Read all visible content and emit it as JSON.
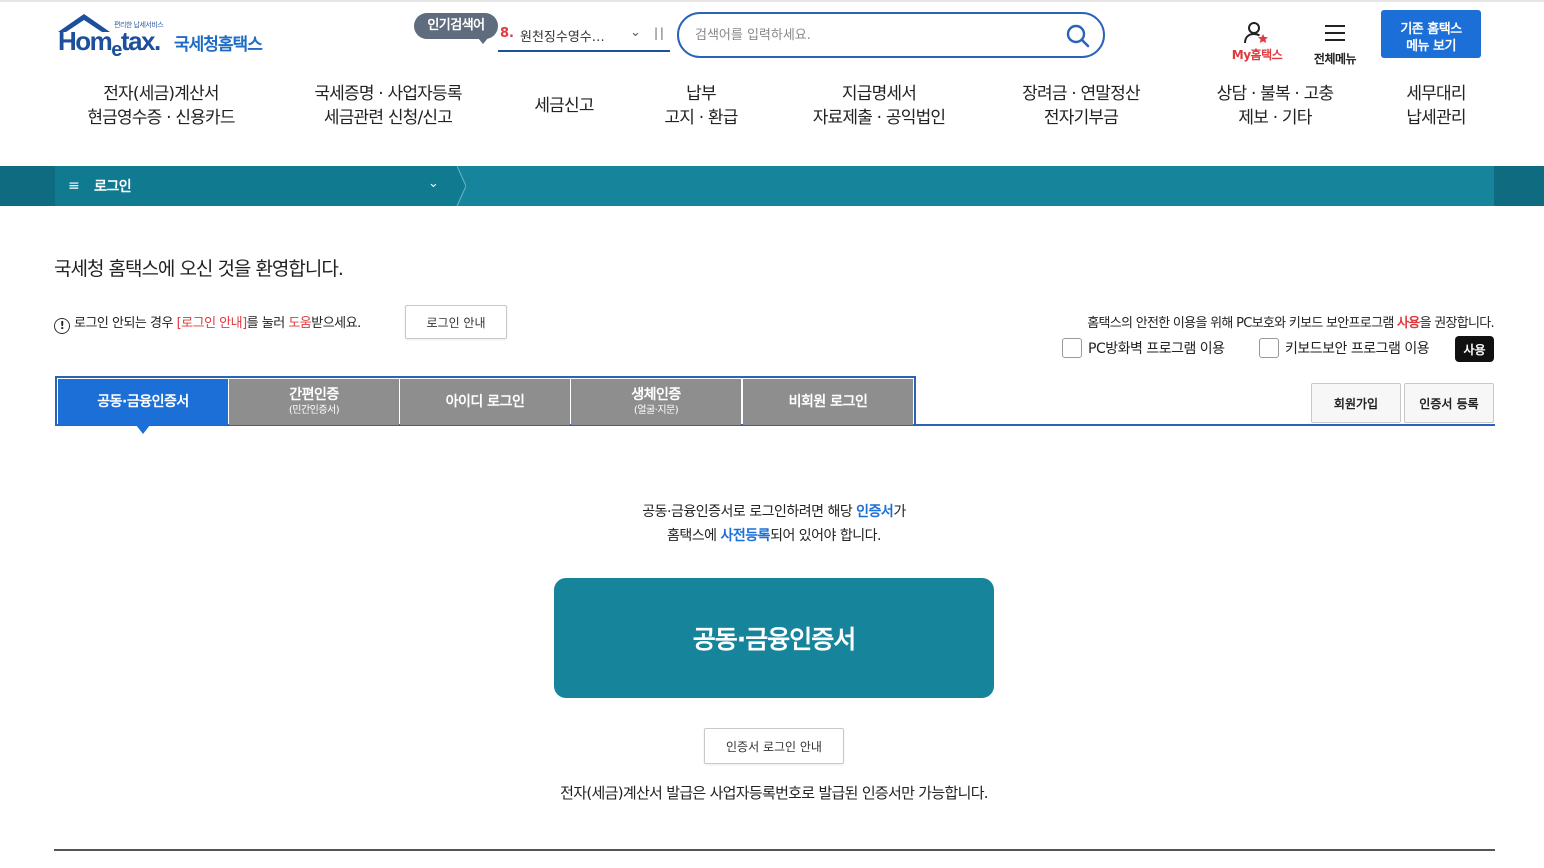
{
  "header": {
    "logo": {
      "small_text": "편리한 납세서비스",
      "word": "Hometax",
      "korean": "국세청홈택스"
    },
    "popular": {
      "label": "인기검색어",
      "rank": "8.",
      "text": "원천징수영수…"
    },
    "search": {
      "placeholder": "검색어를 입력하세요."
    },
    "my_label": "My홈택스",
    "all_menu_label": "전체메뉴",
    "old_menu": {
      "line1": "기존 홈택스",
      "line2": "메뉴 보기"
    }
  },
  "gnb": [
    {
      "line1": "전자(세금)계산서",
      "line2": "현금영수증 · 신용카드"
    },
    {
      "line1": "국세증명 · 사업자등록",
      "line2": "세금관련 신청/신고"
    },
    {
      "line1": "세금신고",
      "line2": ""
    },
    {
      "line1": "납부",
      "line2": "고지 · 환급"
    },
    {
      "line1": "지급명세서",
      "line2": "자료제출 · 공익법인"
    },
    {
      "line1": "장려금 · 연말정산",
      "line2": "전자기부금"
    },
    {
      "line1": "상담 · 불복 · 고충",
      "line2": "제보 · 기타"
    },
    {
      "line1": "세무대리",
      "line2": "납세관리"
    }
  ],
  "location": {
    "title": "로그인"
  },
  "content": {
    "welcome": "국세청 홈택스에 오신 것을 환영합니다.",
    "notice": {
      "pre": "로그인 안되는 경우 ",
      "link": "[로그인 안내]",
      "mid": "를 눌러 ",
      "help": "도움",
      "post": "받으세요."
    },
    "guide_button": "로그인 안내",
    "security": {
      "pre": "홈택스의 안전한 이용을 위해 PC보호와 키보드 보안프로그램 ",
      "highlight": "사용",
      "post": "을 권장합니다.",
      "pc_firewall": "PC방화벽 프로그램 이용",
      "keyboard": "키보드보안 프로그램 이용",
      "use_button": "사용"
    },
    "tabs": [
      {
        "main": "공동·금융인증서",
        "sub": ""
      },
      {
        "main": "간편인증",
        "sub": "(민간인증서)"
      },
      {
        "main": "아이디 로그인",
        "sub": ""
      },
      {
        "main": "생체인증",
        "sub": "(얼굴·지문)"
      },
      {
        "main": "비회원 로그인",
        "sub": ""
      }
    ],
    "signup_button": "회원가입",
    "cert_register_button": "인증서 등록",
    "desc": {
      "l1_pre": "공동·금융인증서로 로그인하려면 해당 ",
      "l1_blue": "인증서",
      "l1_post": "가",
      "l2_pre": "홈택스에 ",
      "l2_blue": "사전등록",
      "l2_post": "되어 있어야 합니다."
    },
    "cert_button": "공동·금융인증서",
    "cert_guide_button": "인증서 로그인 안내",
    "bottom_note": "전자(세금)계산서 발급은 사업자등록번호로 발급된 인증서만 가능합니다."
  },
  "colors": {
    "brand_blue": "#1b6fd6",
    "teal": "#16859b",
    "accent_red": "#e0393e",
    "tab_gray": "#8e8e8e"
  }
}
